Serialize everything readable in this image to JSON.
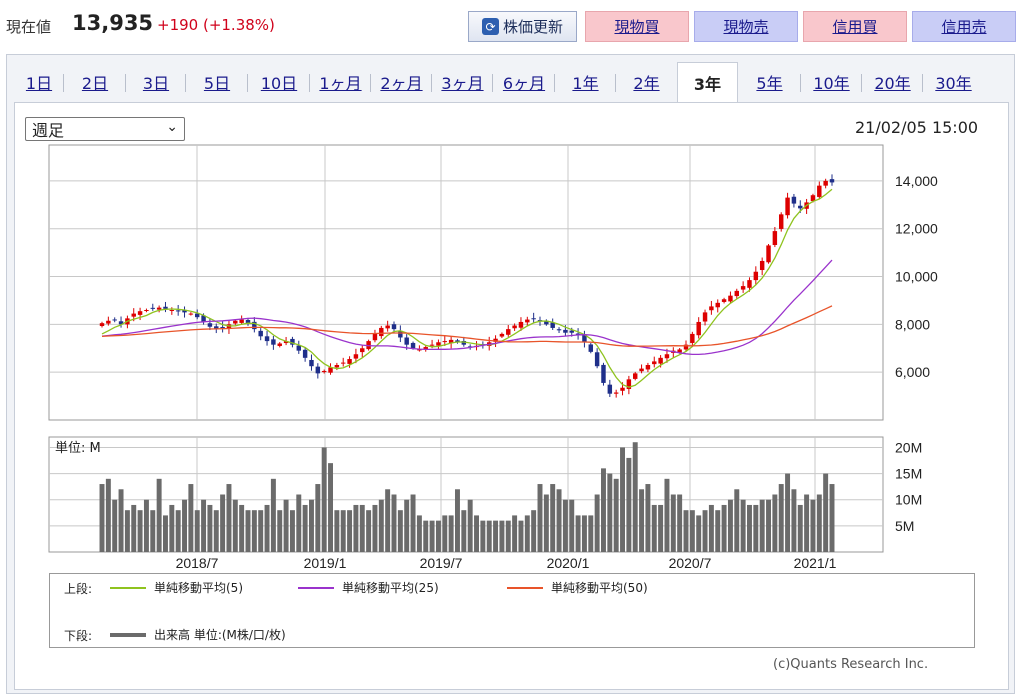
{
  "header": {
    "price_label": "現在値",
    "price_value": "13,935",
    "price_change": "+190 (+1.38%)",
    "refresh_label": "株価更新",
    "buttons": [
      {
        "label": "現物買",
        "kind": "buy"
      },
      {
        "label": "現物売",
        "kind": "sell"
      },
      {
        "label": "信用買",
        "kind": "buy"
      },
      {
        "label": "信用売",
        "kind": "sell"
      }
    ],
    "colors": {
      "up": "#d0021b",
      "buy_bg": "#f9c7cc",
      "sell_bg": "#c9cdf6",
      "link": "#1a1a8c"
    }
  },
  "tabs": {
    "items": [
      "1日",
      "2日",
      "3日",
      "5日",
      "10日",
      "1ヶ月",
      "2ヶ月",
      "3ヶ月",
      "6ヶ月",
      "1年",
      "2年",
      "3年",
      "5年",
      "10年",
      "20年",
      "30年"
    ],
    "active_index": 11
  },
  "controls": {
    "period_select": "週足",
    "timestamp": "21/02/05 15:00"
  },
  "chart_data": {
    "type": "candlestick",
    "price_axis": {
      "ticks": [
        "6,000",
        "8,000",
        "10,000",
        "12,000",
        "14,000"
      ],
      "ylim": [
        4000,
        15500
      ],
      "grid": true
    },
    "volume_axis": {
      "ticks": [
        "5M",
        "10M",
        "15M",
        "20M"
      ],
      "ylim": [
        0,
        22
      ],
      "unit_label": "単位: M",
      "grid": true
    },
    "x_tick_labels": [
      "2018/7",
      "2019/1",
      "2019/7",
      "2020/1",
      "2020/7",
      "2021/1"
    ],
    "close_series": [
      8050,
      8150,
      8200,
      8000,
      8250,
      8450,
      8550,
      8600,
      8650,
      8700,
      8650,
      8600,
      8550,
      8500,
      8450,
      8300,
      8100,
      7900,
      7800,
      7850,
      8000,
      8150,
      8200,
      8050,
      7800,
      7500,
      7300,
      7150,
      7200,
      7300,
      7150,
      6900,
      6600,
      6250,
      5950,
      6050,
      6200,
      6300,
      6400,
      6550,
      6750,
      7000,
      7300,
      7600,
      7850,
      7950,
      7800,
      7450,
      7150,
      7000,
      6950,
      7050,
      7150,
      7250,
      7300,
      7350,
      7250,
      7150,
      7050,
      7100,
      7150,
      7250,
      7400,
      7600,
      7800,
      7950,
      8100,
      8200,
      8250,
      8150,
      8000,
      7850,
      7750,
      7650,
      7650,
      7550,
      7250,
      6850,
      6250,
      5550,
      5100,
      5150,
      5350,
      5700,
      5950,
      6150,
      6300,
      6450,
      6600,
      6750,
      6900,
      6950,
      7150,
      7600,
      8100,
      8500,
      8750,
      8900,
      9050,
      9200,
      9400,
      9600,
      9850,
      10200,
      10650,
      11300,
      11900,
      12600,
      13300,
      13050,
      12850,
      13100,
      13400,
      13800,
      14000,
      13935
    ],
    "volume_series": [
      13,
      14,
      10,
      12,
      8,
      9,
      8,
      10,
      8,
      14,
      7,
      9,
      8,
      10,
      13,
      8,
      10,
      9,
      8,
      11,
      13,
      10,
      9,
      8,
      8,
      8,
      9,
      14,
      8,
      10,
      8,
      11,
      9,
      10,
      13,
      20,
      17,
      8,
      8,
      8,
      9,
      9,
      8,
      9,
      10,
      12,
      11,
      8,
      10,
      11,
      7,
      6,
      6,
      6,
      7,
      7,
      12,
      8,
      10,
      7,
      6,
      6,
      6,
      6,
      6,
      7,
      6,
      7,
      8,
      13,
      11,
      13,
      12,
      10,
      10,
      7,
      7,
      7,
      11,
      16,
      15,
      14,
      20,
      18,
      21,
      12,
      13,
      9,
      9,
      14,
      11,
      11,
      8,
      8,
      7,
      8,
      9,
      8,
      9,
      10,
      12,
      10,
      9,
      9,
      10,
      10,
      11,
      13,
      15,
      12,
      9,
      11,
      10,
      11,
      15,
      13
    ],
    "series": [
      {
        "name": "単純移動平均(5)",
        "color": "#8fc31f",
        "values": []
      },
      {
        "name": "単純移動平均(25)",
        "color": "#9a33cc",
        "values": []
      },
      {
        "name": "単純移動平均(50)",
        "color": "#e8542a",
        "values": []
      }
    ],
    "legend": {
      "upper_label": "上段:",
      "lower_label": "下段:",
      "volume_entry": "出来高 単位:(M株/口/枚)"
    },
    "colors": {
      "up": "#dd0000",
      "down": "#1f2f8a",
      "volume": "#6b6b6b",
      "ma_short": "#8fc31f",
      "ma_mid": "#9a33cc",
      "ma_long": "#e8542a"
    }
  },
  "footer": {
    "credit": "(c)Quants Research Inc."
  }
}
